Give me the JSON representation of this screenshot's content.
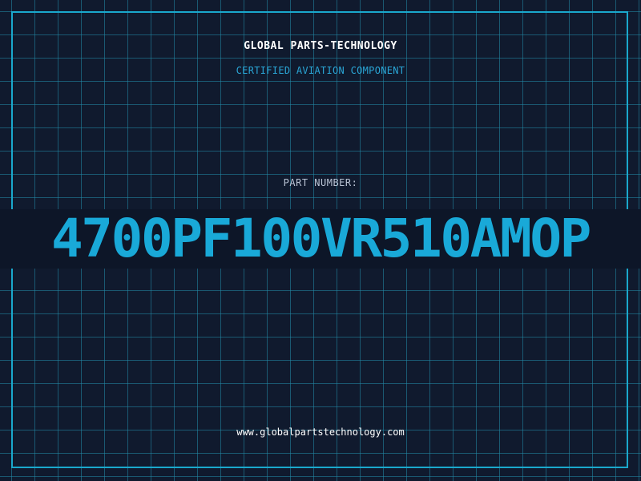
{
  "header": {
    "company": "GLOBAL PARTS-TECHNOLOGY",
    "subtitle": "CERTIFIED AVIATION COMPONENT"
  },
  "part": {
    "label": "PART NUMBER:",
    "number": "4700PF100VR510AMOP"
  },
  "footer": {
    "website": "www.globalpartstechnology.com"
  },
  "colors": {
    "background": "#101a2e",
    "grid": "#228caa",
    "frame": "#1aa8cc",
    "accent": "#19a9d8",
    "band": "#0d1628"
  }
}
